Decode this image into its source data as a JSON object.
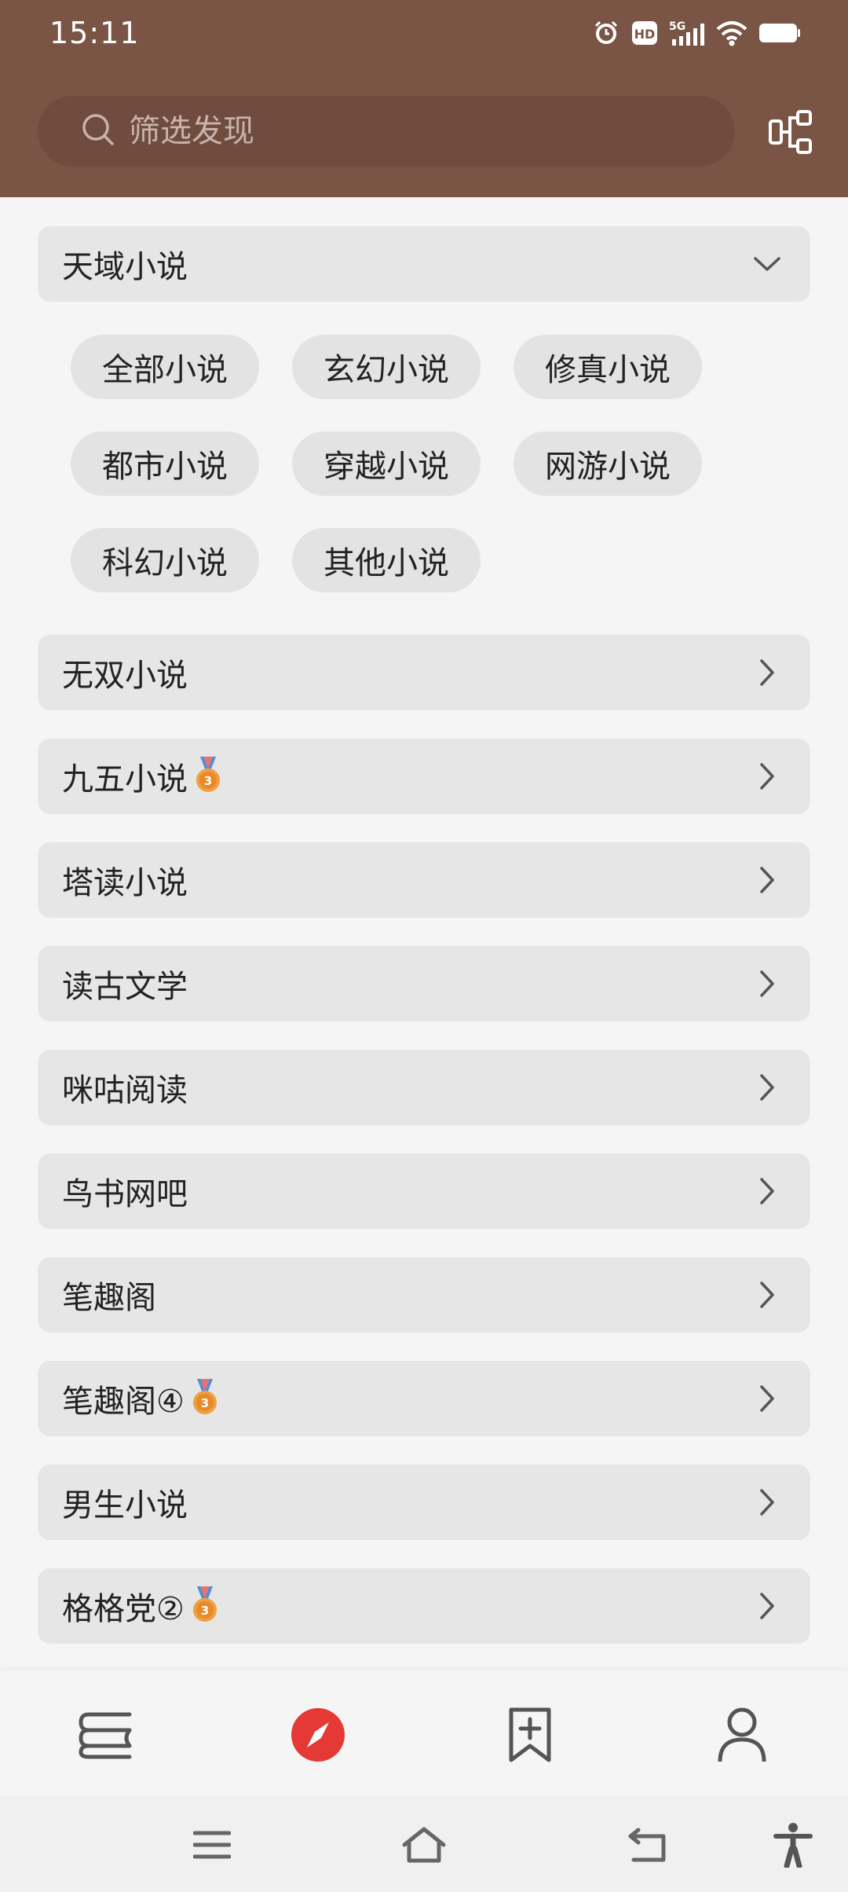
{
  "status_bar": {
    "time": "15:11",
    "icons": [
      "alarm-icon",
      "hd-icon",
      "5g-signal-icon",
      "wifi-icon",
      "battery-icon"
    ],
    "network_label": "5G",
    "hd_label": "HD"
  },
  "header": {
    "search_placeholder": "筛选发现",
    "search_icon": "search-icon",
    "right_icon": "tree-structure-icon",
    "background_color": "#7a5546"
  },
  "expanded_group": {
    "title": "天域小说",
    "chips": [
      "全部小说",
      "玄幻小说",
      "修真小说",
      "都市小说",
      "穿越小说",
      "网游小说",
      "科幻小说",
      "其他小说"
    ]
  },
  "groups": [
    {
      "title": "无双小说",
      "medal": false
    },
    {
      "title": "九五小说",
      "medal": true
    },
    {
      "title": "塔读小说",
      "medal": false
    },
    {
      "title": "读古文学",
      "medal": false
    },
    {
      "title": "咪咕阅读",
      "medal": false
    },
    {
      "title": "鸟书网吧",
      "medal": false
    },
    {
      "title": "笔趣阁",
      "medal": false
    },
    {
      "title": "笔趣阁④",
      "medal": true
    },
    {
      "title": "男生小说",
      "medal": false
    },
    {
      "title": "格格党②",
      "medal": true
    }
  ],
  "bottom_nav": {
    "items": [
      "bookshelf-icon",
      "discover-compass-icon",
      "bookmark-add-icon",
      "profile-icon"
    ],
    "active_index": 1,
    "active_color": "#e53935"
  },
  "system_nav": [
    "menu-icon",
    "home-icon",
    "back-icon",
    "accessibility-icon"
  ]
}
